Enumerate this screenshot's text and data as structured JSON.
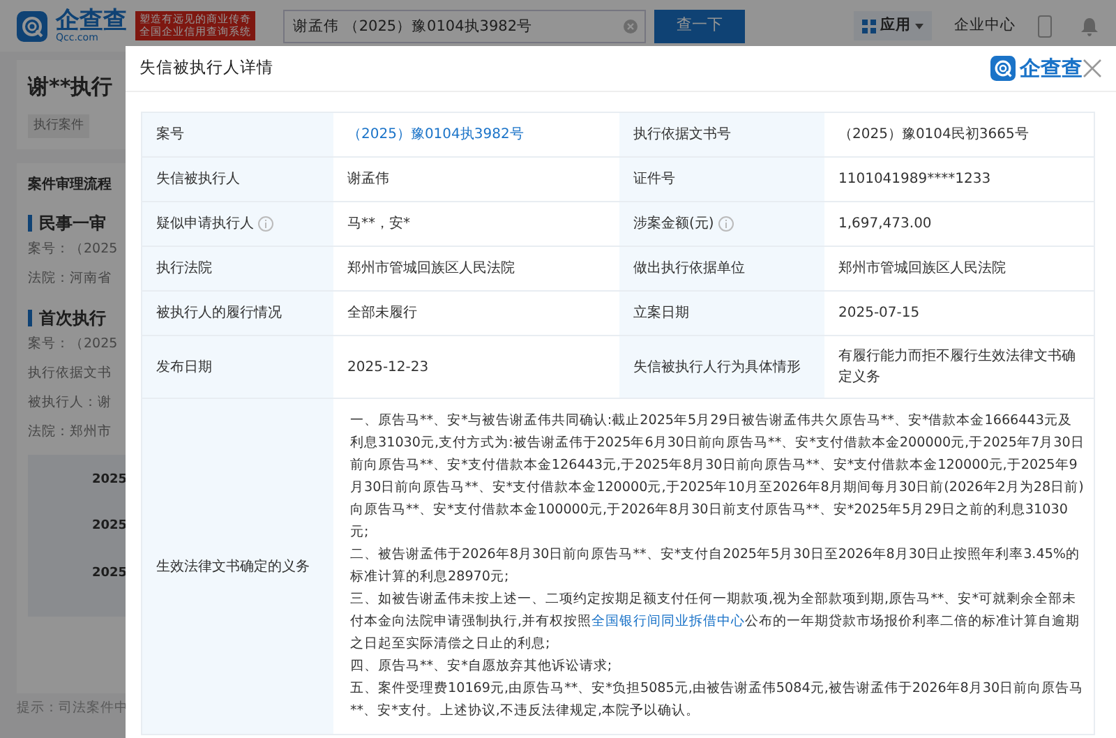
{
  "header": {
    "logo_text": "企查查",
    "logo_domain": "Qcc.com",
    "slogan": [
      "塑造有远见的商业传奇",
      "全国企业信用查询系统"
    ],
    "search": {
      "value": "谢孟伟 （2025）豫0104执3982号"
    },
    "search_button": "查一下",
    "menu": [
      {
        "label": "应用",
        "kind": "dropdown"
      },
      {
        "label": "企业中心",
        "kind": "link"
      }
    ]
  },
  "background": {
    "title": "谢**执行",
    "tags": [
      "执行案件"
    ],
    "flow_card": {
      "title": "案件审理流程",
      "sections": [
        {
          "heading": "民事一审",
          "lines": [
            "案号：（2025",
            "法院：河南省"
          ]
        },
        {
          "heading": "首次执行",
          "lines": [
            "案号：（2025",
            "执行依据文书",
            "被执行人：谢",
            "法院：郑州市"
          ]
        }
      ],
      "timeline": [
        "2025",
        "2025",
        "2025"
      ]
    },
    "footer": "提示：司法案件中"
  },
  "modal": {
    "title": "失信被执行人详情",
    "logo_text": "企查查",
    "rows": [
      {
        "cells": [
          {
            "label": "案号",
            "value": "（2025）豫0104执3982号",
            "link": true
          },
          {
            "label": "执行依据文书号",
            "value": "（2025）豫0104民初3665号"
          }
        ]
      },
      {
        "cells": [
          {
            "label": "失信被执行人",
            "value": "谢孟伟"
          },
          {
            "label": "证件号",
            "value": "1101041989****1233"
          }
        ]
      },
      {
        "cells": [
          {
            "label": "疑似申请执行人",
            "value": "马**，安*",
            "info": true
          },
          {
            "label": "涉案金额(元)",
            "value": "1,697,473.00",
            "info": true
          }
        ]
      },
      {
        "cells": [
          {
            "label": "执行法院",
            "value": "郑州市管城回族区人民法院"
          },
          {
            "label": "做出执行依据单位",
            "value": "郑州市管城回族区人民法院"
          }
        ]
      },
      {
        "cells": [
          {
            "label": "被执行人的履行情况",
            "value": "全部未履行"
          },
          {
            "label": "立案日期",
            "value": "2025-07-15"
          }
        ]
      },
      {
        "cells": [
          {
            "label": "发布日期",
            "value": "2025-12-23"
          },
          {
            "label": "失信被执行人行为具体情形",
            "value": "有履行能力而拒不履行生效法律文书确定义务"
          }
        ]
      }
    ],
    "obligations": {
      "label": "生效法律文书确定的义务",
      "paragraphs": [
        {
          "text": "一、原告马**、安*与被告谢孟伟共同确认:截止2025年5月29日被告谢孟伟共欠原告马**、安*借款本金1666443元及利息31030元,支付方式为:被告谢孟伟于2025年6月30日前向原告马**、安*支付借款本金200000元,于2025年7月30日前向原告马**、安*支付借款本金126443元,于2025年8月30日前向原告马**、安*支付借款本金120000元,于2025年9月30日前向原告马**、安*支付借款本金120000元,于2025年10月至2026年8月期间每月30日前(2026年2月为28日前)向原告马**、安*支付借款本金100000元,于2026年8月30日前支付原告马**、安*2025年5月29日之前的利息31030元;"
        },
        {
          "text": "二、被告谢孟伟于2026年8月30日前向原告马**、安*支付自2025年5月30日至2026年8月30日止按照年利率3.45%的标准计算的利息28970元;"
        },
        {
          "text": "三、如被告谢孟伟未按上述一、二项约定按期足额支付任何一期款项,视为全部款项到期,原告马**、安*可就剩余全部未付本金向法院申请强制执行,并有权按照",
          "link": "全国银行间同业拆借中心",
          "after": "公布的一年期贷款市场报价利率二倍的标准计算自逾期之日起至实际清偿之日止的利息;"
        },
        {
          "text": "四、原告马**、安*自愿放弃其他诉讼请求;"
        },
        {
          "text": "五、案件受理费10169元,由原告马**、安*负担5085元,由被告谢孟伟5084元,被告谢孟伟于2026年8月30日前向原告马**、安*支付。上述协议,不违反法律规定,本院予以确认。"
        }
      ]
    }
  }
}
